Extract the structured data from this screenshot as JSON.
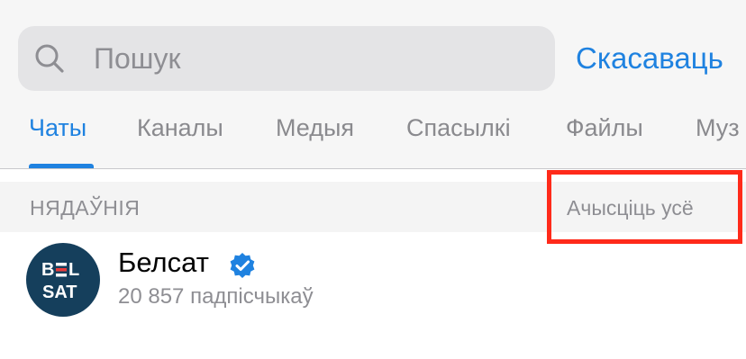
{
  "search": {
    "placeholder": "Пошук",
    "cancel_label": "Скасаваць"
  },
  "tabs": [
    {
      "label": "Чаты",
      "active": true
    },
    {
      "label": "Каналы",
      "active": false
    },
    {
      "label": "Медыя",
      "active": false
    },
    {
      "label": "Спасылкі",
      "active": false
    },
    {
      "label": "Файлы",
      "active": false
    },
    {
      "label": "Муз",
      "active": false
    }
  ],
  "recent": {
    "title": "НЯДАЎНІЯ",
    "clear_all_label": "Ачысціць усё"
  },
  "results": [
    {
      "name": "Белсат",
      "subtitle": "20 857 падпісчыкаў",
      "verified": true,
      "avatar_icon": "belsat-logo",
      "avatar_text_top": "BELSAT"
    }
  ],
  "colors": {
    "accent": "#1f82e0",
    "secondary_text": "#8e8e93",
    "highlight": "#ff2a1a",
    "avatar_bg": "#153f5c"
  }
}
